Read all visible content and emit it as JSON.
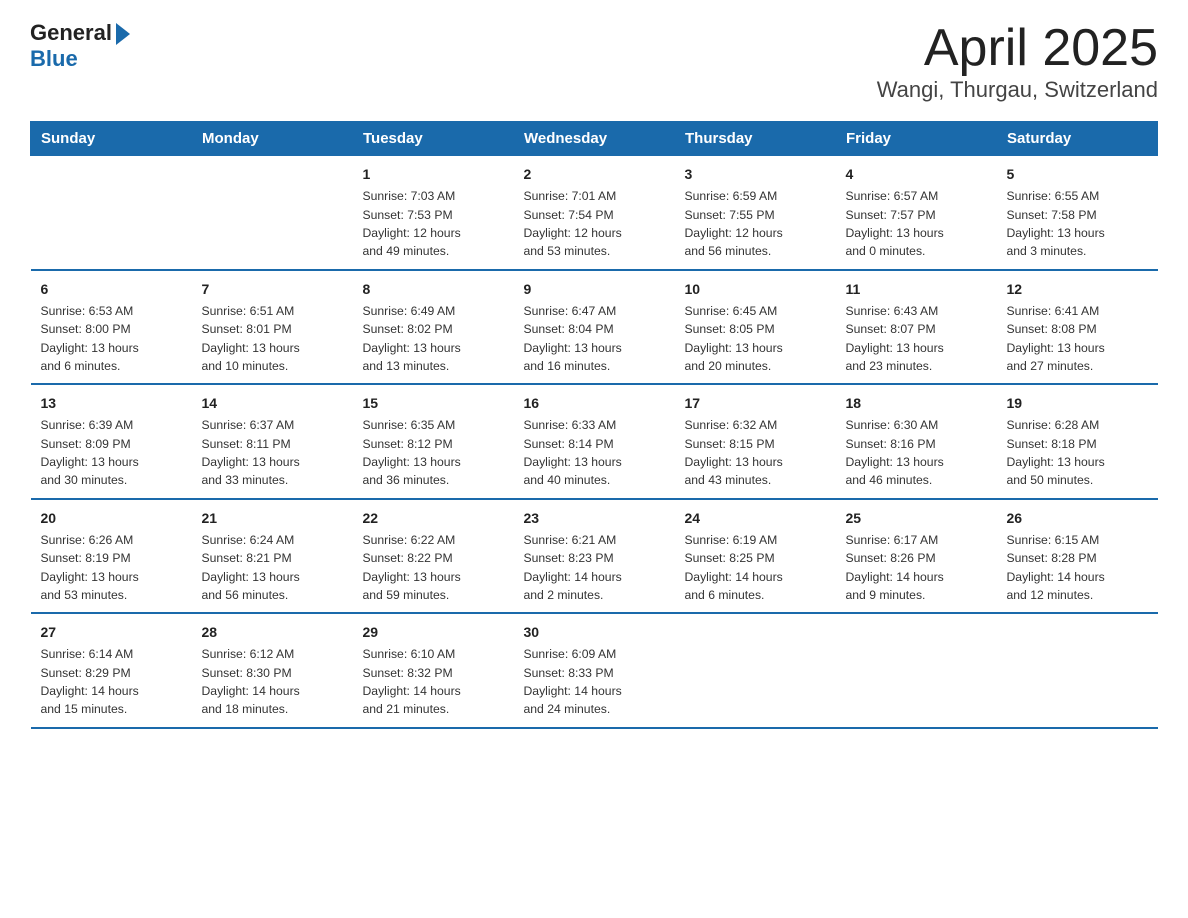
{
  "header": {
    "logo_general": "General",
    "logo_arrow": "▶",
    "logo_blue": "Blue",
    "title": "April 2025",
    "subtitle": "Wangi, Thurgau, Switzerland"
  },
  "calendar": {
    "days_of_week": [
      "Sunday",
      "Monday",
      "Tuesday",
      "Wednesday",
      "Thursday",
      "Friday",
      "Saturday"
    ],
    "weeks": [
      [
        {
          "day": "",
          "info": ""
        },
        {
          "day": "",
          "info": ""
        },
        {
          "day": "1",
          "info": "Sunrise: 7:03 AM\nSunset: 7:53 PM\nDaylight: 12 hours\nand 49 minutes."
        },
        {
          "day": "2",
          "info": "Sunrise: 7:01 AM\nSunset: 7:54 PM\nDaylight: 12 hours\nand 53 minutes."
        },
        {
          "day": "3",
          "info": "Sunrise: 6:59 AM\nSunset: 7:55 PM\nDaylight: 12 hours\nand 56 minutes."
        },
        {
          "day": "4",
          "info": "Sunrise: 6:57 AM\nSunset: 7:57 PM\nDaylight: 13 hours\nand 0 minutes."
        },
        {
          "day": "5",
          "info": "Sunrise: 6:55 AM\nSunset: 7:58 PM\nDaylight: 13 hours\nand 3 minutes."
        }
      ],
      [
        {
          "day": "6",
          "info": "Sunrise: 6:53 AM\nSunset: 8:00 PM\nDaylight: 13 hours\nand 6 minutes."
        },
        {
          "day": "7",
          "info": "Sunrise: 6:51 AM\nSunset: 8:01 PM\nDaylight: 13 hours\nand 10 minutes."
        },
        {
          "day": "8",
          "info": "Sunrise: 6:49 AM\nSunset: 8:02 PM\nDaylight: 13 hours\nand 13 minutes."
        },
        {
          "day": "9",
          "info": "Sunrise: 6:47 AM\nSunset: 8:04 PM\nDaylight: 13 hours\nand 16 minutes."
        },
        {
          "day": "10",
          "info": "Sunrise: 6:45 AM\nSunset: 8:05 PM\nDaylight: 13 hours\nand 20 minutes."
        },
        {
          "day": "11",
          "info": "Sunrise: 6:43 AM\nSunset: 8:07 PM\nDaylight: 13 hours\nand 23 minutes."
        },
        {
          "day": "12",
          "info": "Sunrise: 6:41 AM\nSunset: 8:08 PM\nDaylight: 13 hours\nand 27 minutes."
        }
      ],
      [
        {
          "day": "13",
          "info": "Sunrise: 6:39 AM\nSunset: 8:09 PM\nDaylight: 13 hours\nand 30 minutes."
        },
        {
          "day": "14",
          "info": "Sunrise: 6:37 AM\nSunset: 8:11 PM\nDaylight: 13 hours\nand 33 minutes."
        },
        {
          "day": "15",
          "info": "Sunrise: 6:35 AM\nSunset: 8:12 PM\nDaylight: 13 hours\nand 36 minutes."
        },
        {
          "day": "16",
          "info": "Sunrise: 6:33 AM\nSunset: 8:14 PM\nDaylight: 13 hours\nand 40 minutes."
        },
        {
          "day": "17",
          "info": "Sunrise: 6:32 AM\nSunset: 8:15 PM\nDaylight: 13 hours\nand 43 minutes."
        },
        {
          "day": "18",
          "info": "Sunrise: 6:30 AM\nSunset: 8:16 PM\nDaylight: 13 hours\nand 46 minutes."
        },
        {
          "day": "19",
          "info": "Sunrise: 6:28 AM\nSunset: 8:18 PM\nDaylight: 13 hours\nand 50 minutes."
        }
      ],
      [
        {
          "day": "20",
          "info": "Sunrise: 6:26 AM\nSunset: 8:19 PM\nDaylight: 13 hours\nand 53 minutes."
        },
        {
          "day": "21",
          "info": "Sunrise: 6:24 AM\nSunset: 8:21 PM\nDaylight: 13 hours\nand 56 minutes."
        },
        {
          "day": "22",
          "info": "Sunrise: 6:22 AM\nSunset: 8:22 PM\nDaylight: 13 hours\nand 59 minutes."
        },
        {
          "day": "23",
          "info": "Sunrise: 6:21 AM\nSunset: 8:23 PM\nDaylight: 14 hours\nand 2 minutes."
        },
        {
          "day": "24",
          "info": "Sunrise: 6:19 AM\nSunset: 8:25 PM\nDaylight: 14 hours\nand 6 minutes."
        },
        {
          "day": "25",
          "info": "Sunrise: 6:17 AM\nSunset: 8:26 PM\nDaylight: 14 hours\nand 9 minutes."
        },
        {
          "day": "26",
          "info": "Sunrise: 6:15 AM\nSunset: 8:28 PM\nDaylight: 14 hours\nand 12 minutes."
        }
      ],
      [
        {
          "day": "27",
          "info": "Sunrise: 6:14 AM\nSunset: 8:29 PM\nDaylight: 14 hours\nand 15 minutes."
        },
        {
          "day": "28",
          "info": "Sunrise: 6:12 AM\nSunset: 8:30 PM\nDaylight: 14 hours\nand 18 minutes."
        },
        {
          "day": "29",
          "info": "Sunrise: 6:10 AM\nSunset: 8:32 PM\nDaylight: 14 hours\nand 21 minutes."
        },
        {
          "day": "30",
          "info": "Sunrise: 6:09 AM\nSunset: 8:33 PM\nDaylight: 14 hours\nand 24 minutes."
        },
        {
          "day": "",
          "info": ""
        },
        {
          "day": "",
          "info": ""
        },
        {
          "day": "",
          "info": ""
        }
      ]
    ]
  }
}
